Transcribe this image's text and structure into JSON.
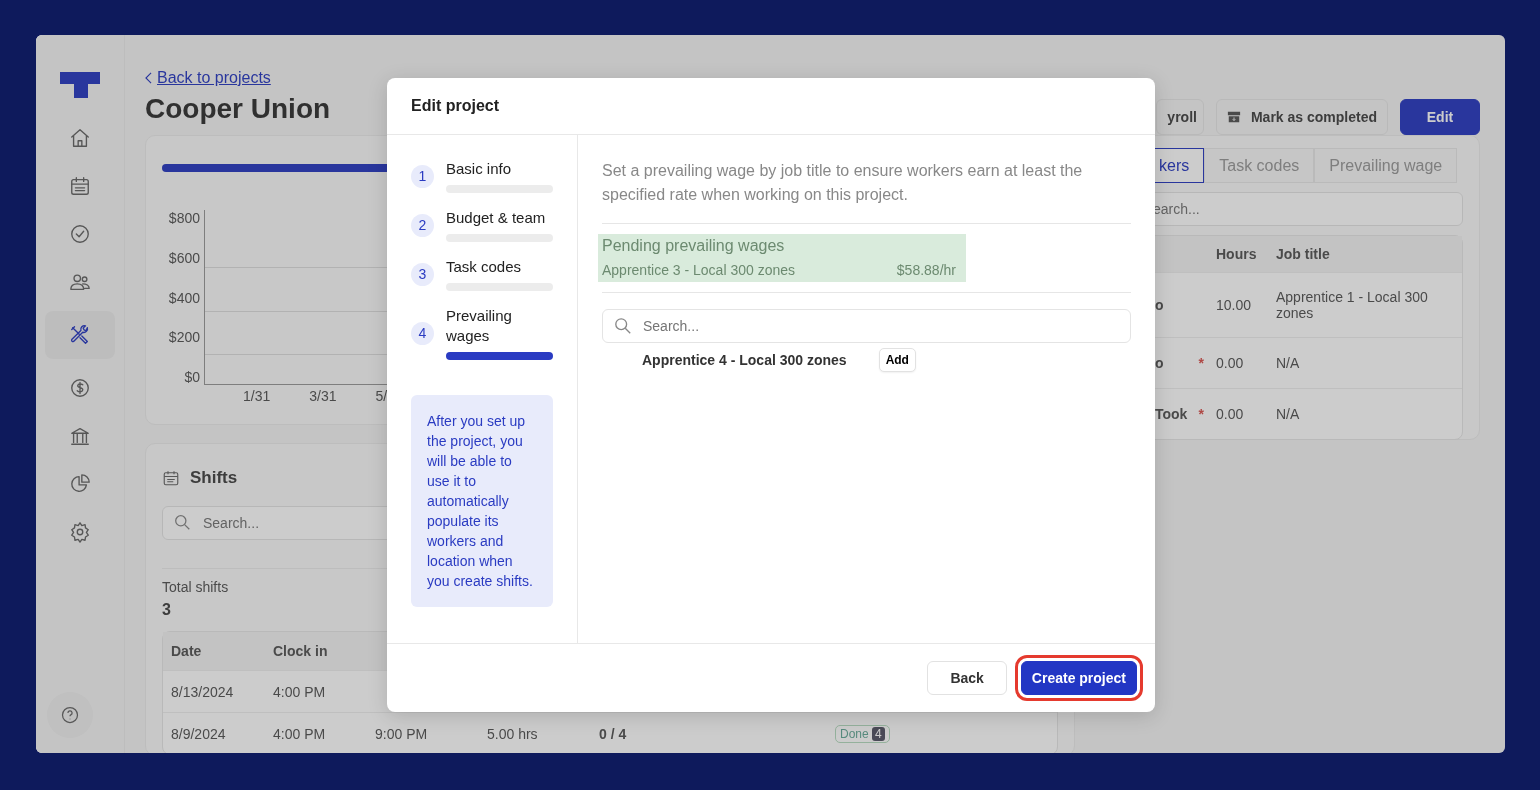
{
  "sidebar": {
    "items": [
      {
        "kind": "home",
        "selected": false
      },
      {
        "kind": "calendar",
        "selected": false
      },
      {
        "kind": "check",
        "selected": false
      },
      {
        "kind": "people",
        "selected": false
      },
      {
        "kind": "tools",
        "selected": true
      },
      {
        "kind": "dollar",
        "selected": false
      },
      {
        "kind": "bank",
        "selected": false
      },
      {
        "kind": "pie",
        "selected": false
      },
      {
        "kind": "gear",
        "selected": false
      }
    ]
  },
  "header": {
    "back_link": "Back to projects",
    "title": "Cooper Union",
    "buttons": [
      {
        "label": "yroll",
        "kind": "plain"
      },
      {
        "label": "Mark as completed",
        "kind": "archive"
      },
      {
        "label": "Edit",
        "kind": "primary"
      }
    ]
  },
  "progress": {
    "level": 1
  },
  "chart": {
    "y_labels": [
      "$800",
      "$600",
      "$400",
      "$200",
      "$0"
    ],
    "x_labels": [
      "1/31",
      "3/31",
      "5/"
    ]
  },
  "shifts": {
    "title": "Shifts",
    "search_placeholder": "Search...",
    "total_label": "Total shifts",
    "total": "3",
    "columns": [
      "Date",
      "Clock in"
    ],
    "rows": [
      [
        "8/13/2024",
        "4:00 PM"
      ],
      [
        "8/9/2024",
        "4:00 PM",
        "9:00 PM",
        "5.00 hrs",
        "0 / 4"
      ]
    ],
    "status": {
      "label": "Done",
      "count": "4"
    }
  },
  "workers": {
    "tabs": [
      {
        "label": "kers",
        "selected": true
      },
      {
        "label": "Task codes",
        "selected": false
      },
      {
        "label": "Prevailing wage",
        "selected": false
      }
    ],
    "search_placeholder": "earch...",
    "columns": [
      "Hours",
      "Job title"
    ],
    "rows": [
      {
        "name": "o",
        "hours": "10.00",
        "job": "Apprentice 1 - Local 300 zones"
      },
      {
        "name": "o",
        "required_mark": "*",
        "hours": "0.00",
        "job": "N/A"
      },
      {
        "name": "Took",
        "required_mark": "*",
        "hours": "0.00",
        "job": "N/A"
      }
    ]
  },
  "modal": {
    "title": "Edit project",
    "steps": [
      {
        "number": "1",
        "label": "Basic info",
        "selected": false
      },
      {
        "number": "2",
        "label": "Budget & team",
        "selected": false
      },
      {
        "number": "3",
        "label": "Task codes",
        "selected": false
      },
      {
        "number": "4",
        "label": "Prevailing wages",
        "selected": true
      }
    ],
    "info": "After you set up the project, you will be able to use it to automatically populate its workers and location when you create shifts.",
    "description": "Set a prevailing wage by job title to ensure workers earn at least the specified rate when working on this project.",
    "pending": {
      "title": "Pending prevailing wages",
      "items": [
        {
          "name": "Apprentice 3 - Local 300 zones",
          "rate": "$58.88/hr"
        }
      ]
    },
    "search_placeholder": "Search...",
    "options": [
      {
        "name": "Apprentice 4 - Local 300 zones",
        "action": "Add"
      }
    ],
    "buttons": [
      {
        "label": "Back",
        "kind": "secondary",
        "highlighted": false
      },
      {
        "label": "Create project",
        "kind": "primary",
        "highlighted": true
      }
    ]
  }
}
